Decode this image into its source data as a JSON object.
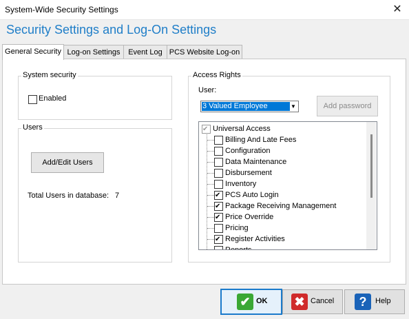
{
  "window": {
    "title": "System-Wide Security Settings",
    "close_glyph": "✕"
  },
  "heading": "Security Settings and Log-On Settings",
  "tabs": [
    {
      "label": "General Security",
      "active": true
    },
    {
      "label": "Log-on Settings",
      "active": false
    },
    {
      "label": "Event Log",
      "active": false
    },
    {
      "label": "PCS Website Log-on",
      "active": false
    }
  ],
  "system_security": {
    "legend": "System security",
    "enabled_label": "Enabled",
    "enabled_checked": false
  },
  "users": {
    "legend": "Users",
    "add_edit_label": "Add/Edit Users",
    "total_label": "Total Users in database:",
    "total_value": "7"
  },
  "access_rights": {
    "legend": "Access Rights",
    "user_label": "User:",
    "user_selected": "3 Valued Employee",
    "add_password_label": "Add password",
    "root": {
      "label": "Universal Access",
      "checked": true
    },
    "items": [
      {
        "label": "Billing And Late Fees",
        "checked": false
      },
      {
        "label": "Configuration",
        "checked": false
      },
      {
        "label": "Data Maintenance",
        "checked": false
      },
      {
        "label": "Disbursement",
        "checked": false
      },
      {
        "label": "Inventory",
        "checked": false
      },
      {
        "label": "PCS Auto Login",
        "checked": true
      },
      {
        "label": "Package Receiving Management",
        "checked": true
      },
      {
        "label": "Price Override",
        "checked": true
      },
      {
        "label": "Pricing",
        "checked": false
      },
      {
        "label": "Register Activities",
        "checked": true
      },
      {
        "label": "Reports",
        "checked": false
      }
    ]
  },
  "buttons": {
    "ok": "OK",
    "cancel": "Cancel",
    "help": "Help"
  },
  "icons": {
    "ok": "check-icon",
    "cancel": "x-icon",
    "help": "question-icon"
  },
  "colors": {
    "heading": "#1f7ec8",
    "selection": "#0078d7",
    "ok_icon": "#3aa835",
    "cancel_icon": "#d02a2a",
    "help_icon": "#1a63b8"
  }
}
